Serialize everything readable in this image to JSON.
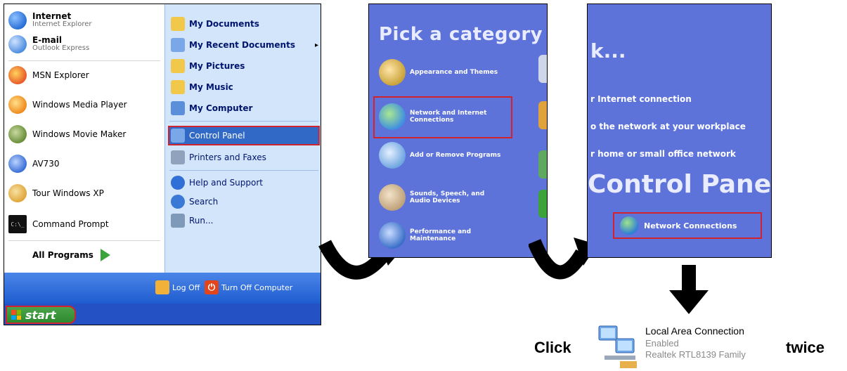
{
  "start_menu": {
    "left_items": [
      {
        "title": "Internet",
        "subtitle": "Internet Explorer",
        "bold": true,
        "color": "#2a6fd6"
      },
      {
        "title": "E-mail",
        "subtitle": "Outlook Express",
        "bold": true,
        "color": "#4f8ee0"
      },
      {
        "title": "MSN Explorer",
        "subtitle": "",
        "bold": false,
        "color": "#e85b2a"
      },
      {
        "title": "Windows Media Player",
        "subtitle": "",
        "bold": false,
        "color": "#f08a1c"
      },
      {
        "title": "Windows Movie Maker",
        "subtitle": "",
        "bold": false,
        "color": "#6a8f3a"
      },
      {
        "title": "AV730",
        "subtitle": "",
        "bold": false,
        "color": "#3a6fd6"
      },
      {
        "title": "Tour Windows XP",
        "subtitle": "",
        "bold": false,
        "color": "#e0a63a"
      },
      {
        "title": "Command Prompt",
        "subtitle": "",
        "bold": false,
        "color": "#111111"
      }
    ],
    "all_programs": "All Programs",
    "right_items": [
      {
        "label": "My Documents",
        "bold": true,
        "color": "#f2c84b"
      },
      {
        "label": "My Recent Documents",
        "bold": true,
        "color": "#7aa7e8"
      },
      {
        "label": "My Pictures",
        "bold": true,
        "color": "#f2c84b"
      },
      {
        "label": "My Music",
        "bold": true,
        "color": "#f2c84b"
      },
      {
        "label": "My Computer",
        "bold": true,
        "color": "#5b8fd9"
      },
      {
        "label": "Control Panel",
        "bold": false,
        "color": "#7aa7e8"
      },
      {
        "label": "Printers and Faxes",
        "bold": false,
        "color": "#8fa3bd"
      },
      {
        "label": "Help and Support",
        "bold": false,
        "color": "#2f6fd6"
      },
      {
        "label": "Search",
        "bold": false,
        "color": "#3a7ad6"
      },
      {
        "label": "Run...",
        "bold": false,
        "color": "#7f9ab8"
      }
    ],
    "more_arrow": "▸",
    "log_off": "Log Off",
    "turn_off": "Turn Off Computer",
    "start": "start"
  },
  "panel_category": {
    "title": "Pick a category",
    "categories": [
      {
        "label": "Appearance and Themes",
        "color": "#c9a23a"
      },
      {
        "label": "Network and Internet\nConnections",
        "color": "#3f8fe0"
      },
      {
        "label": "Add or Remove Programs",
        "color": "#6fa6e0"
      },
      {
        "label": "Sounds, Speech, and\nAudio Devices",
        "color": "#bfa27a"
      },
      {
        "label": "Performance and\nMaintenance",
        "color": "#3a6fc8"
      }
    ]
  },
  "panel_network": {
    "heading": "k...",
    "tasks": [
      "r Internet connection",
      "o the network at your workplace",
      "r home or small office network"
    ],
    "cp_heading": "Control Panel ic",
    "network_connections": "Network Connections"
  },
  "instruction": {
    "click": "Click",
    "twice": "twice",
    "connection_name": "Local Area Connection",
    "connection_status": "Enabled",
    "connection_device": "Realtek RTL8139 Family"
  }
}
